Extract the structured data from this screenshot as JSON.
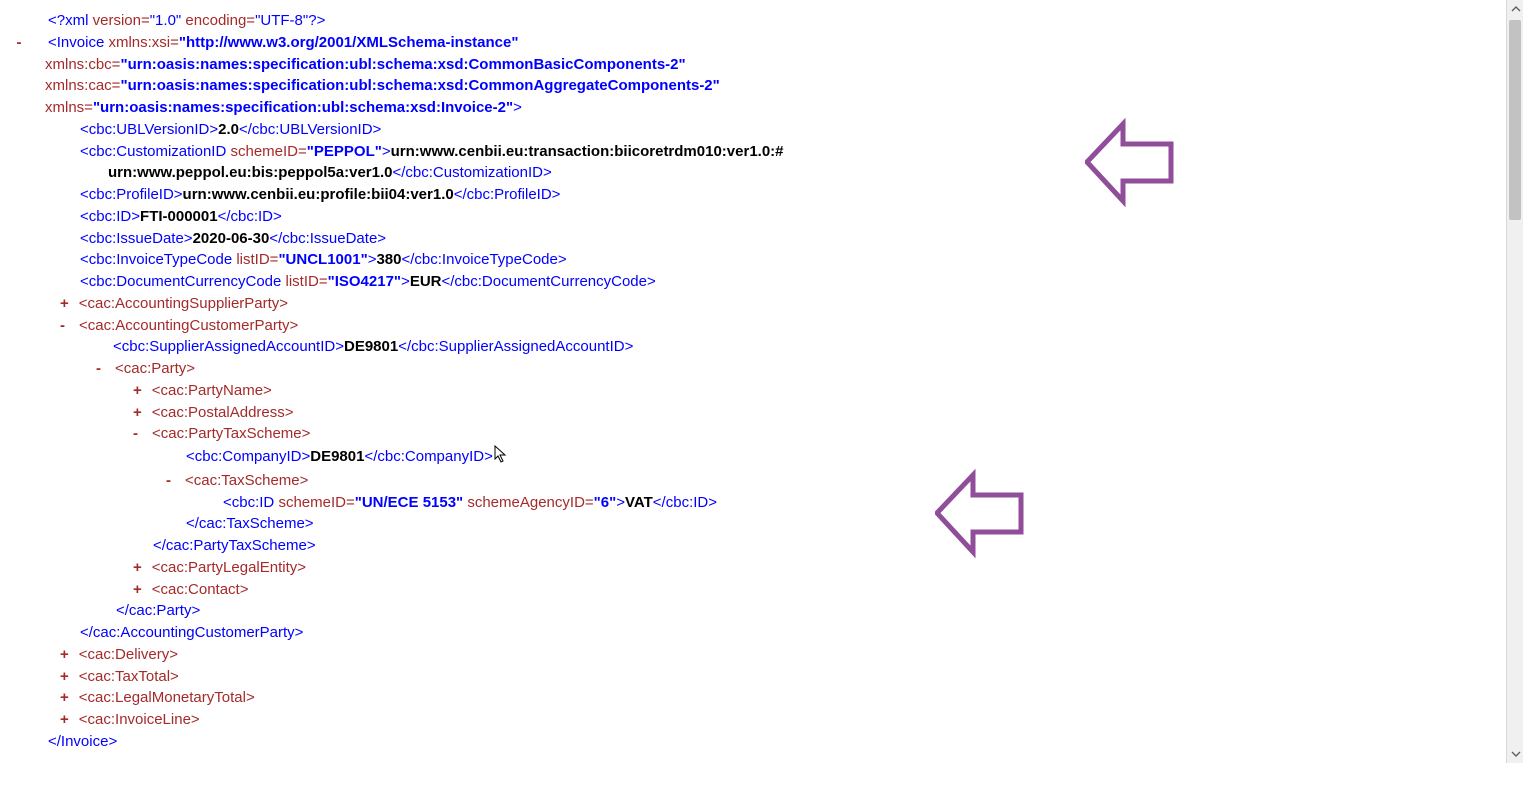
{
  "xmlDecl": {
    "open": "<?xml ",
    "vAttr": "version=",
    "vVal": "\"1.0\"",
    "eAttr": " encoding=",
    "eVal": "\"UTF-8\"",
    "close": "?>"
  },
  "invoice": {
    "toggle": "-",
    "open": "<Invoice ",
    "xsiAttr": "xmlns:xsi=",
    "xsiVal": "\"http://www.w3.org/2001/XMLSchema-instance\"",
    "cbcAttr": "xmlns:cbc=",
    "cbcVal": "\"urn:oasis:names:specification:ubl:schema:xsd:CommonBasicComponents-2\"",
    "cacAttr": "xmlns:cac=",
    "cacVal": "\"urn:oasis:names:specification:ubl:schema:xsd:CommonAggregateComponents-2\"",
    "nsAttr": "xmlns=",
    "nsVal": "\"urn:oasis:names:specification:ubl:schema:xsd:Invoice-2\"",
    "gt": ">",
    "close": "</Invoice>"
  },
  "ublVersion": {
    "open": "<cbc:UBLVersionID>",
    "val": "2.0",
    "close": "</cbc:UBLVersionID>"
  },
  "customization": {
    "open": "<cbc:CustomizationID ",
    "attr": "schemeID=",
    "attrVal": "\"PEPPOL\"",
    "gt": ">",
    "val1": "urn:www.cenbii.eu:transaction:biicoretrdm010:ver1.0:#",
    "val2": "urn:www.peppol.eu:bis:peppol5a:ver1.0",
    "close": "</cbc:CustomizationID>"
  },
  "profile": {
    "open": "<cbc:ProfileID>",
    "val": "urn:www.cenbii.eu:profile:bii04:ver1.0",
    "close": "</cbc:ProfileID>"
  },
  "id": {
    "open": "<cbc:ID>",
    "val": "FTI-000001",
    "close": "</cbc:ID>"
  },
  "issueDate": {
    "open": "<cbc:IssueDate>",
    "val": "2020-06-30",
    "close": "</cbc:IssueDate>"
  },
  "invType": {
    "open": "<cbc:InvoiceTypeCode ",
    "attr": "listID=",
    "attrVal": "\"UNCL1001\"",
    "gt": ">",
    "val": "380",
    "close": "</cbc:InvoiceTypeCode>"
  },
  "currency": {
    "open": "<cbc:DocumentCurrencyCode ",
    "attr": "listID=",
    "attrVal": "\"ISO4217\"",
    "gt": ">",
    "val": "EUR",
    "close": "</cbc:DocumentCurrencyCode>"
  },
  "supplier": {
    "toggle": "+",
    "tag": "<cac:AccountingSupplierParty>"
  },
  "customer": {
    "toggle": "-",
    "open": "<cac:AccountingCustomerParty>",
    "close": "</cac:AccountingCustomerParty>"
  },
  "suppAcct": {
    "open": "<cbc:SupplierAssignedAccountID>",
    "val": "DE9801",
    "close": "</cbc:SupplierAssignedAccountID>"
  },
  "party": {
    "toggle": "-",
    "open": "<cac:Party>",
    "close": "</cac:Party>"
  },
  "partyName": {
    "toggle": "+",
    "tag": "<cac:PartyName>"
  },
  "postal": {
    "toggle": "+",
    "tag": "<cac:PostalAddress>"
  },
  "partyTax": {
    "toggle": "-",
    "open": "<cac:PartyTaxScheme>",
    "close": "</cac:PartyTaxScheme>"
  },
  "companyId": {
    "open": "<cbc:CompanyID>",
    "val": "DE9801",
    "close": "</cbc:CompanyID>"
  },
  "taxScheme": {
    "toggle": "-",
    "open": "<cac:TaxScheme>",
    "close": "</cac:TaxScheme>"
  },
  "taxId": {
    "open": "<cbc:ID ",
    "a1": "schemeID=",
    "v1": "\"UN/ECE 5153\"",
    "sp": " ",
    "a2": "schemeAgencyID=",
    "v2": "\"6\"",
    "gt": ">",
    "val": "VAT",
    "close": "</cbc:ID>"
  },
  "legalEntity": {
    "toggle": "+",
    "tag": "<cac:PartyLegalEntity>"
  },
  "contact": {
    "toggle": "+",
    "tag": "<cac:Contact>"
  },
  "delivery": {
    "toggle": "+",
    "tag": "<cac:Delivery>"
  },
  "taxTotal": {
    "toggle": "+",
    "tag": "<cac:TaxTotal>"
  },
  "legalMon": {
    "toggle": "+",
    "tag": "<cac:LegalMonetaryTotal>"
  },
  "invLine": {
    "toggle": "+",
    "tag": "<cac:InvoiceLine>"
  }
}
